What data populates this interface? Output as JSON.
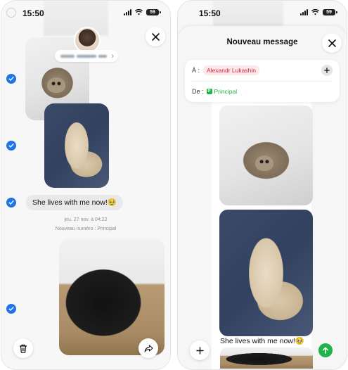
{
  "left_screen": {
    "status": {
      "time": "15:50",
      "battery": "59"
    },
    "contact_name": "",
    "message_bubble": "She lives with me now!🥹",
    "timestamp": "jeu. 27 nov. à 04:22",
    "line_change": "Nouveau numéro : Principal",
    "chevron_glyph": "›",
    "selected_checks": 4
  },
  "right_screen": {
    "status": {
      "time": "15:50",
      "battery": "59"
    },
    "sheet_title": "Nouveau message",
    "to_label": "À :",
    "recipient": "Alexandr Lukashin",
    "from_label": "De :",
    "from_line_letter": "P",
    "from_line": "Principal",
    "compose_text": "She lives with me now!🥹"
  },
  "colors": {
    "accent_blue": "#1e74e8",
    "recipient_red": "#d8263d",
    "line_green": "#22b24c",
    "bubble_grey": "#e9e9eb"
  },
  "icons": {
    "close": "close-icon",
    "check": "checkmark-icon",
    "trash": "trash-icon",
    "share": "share-forward-icon",
    "plus": "plus-icon",
    "send": "arrow-up-icon",
    "wifi": "wifi-icon",
    "signal": "signal-icon",
    "battery": "battery-icon"
  }
}
